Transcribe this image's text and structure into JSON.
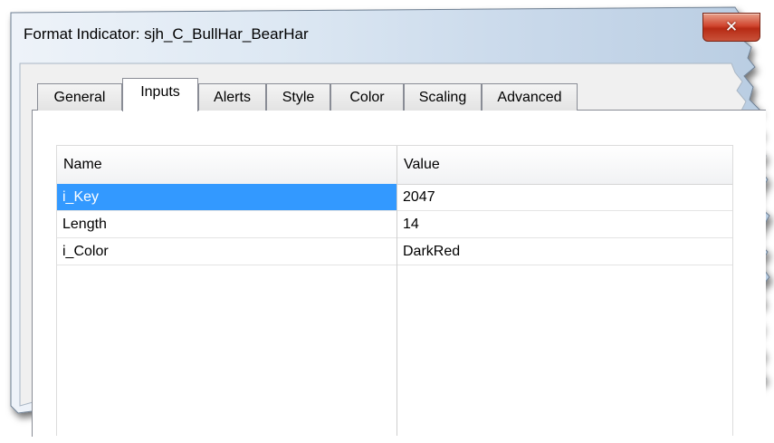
{
  "window": {
    "title": "Format Indicator: sjh_C_BullHar_BearHar",
    "close_glyph": "✕"
  },
  "tabs": [
    {
      "label": "General",
      "active": false
    },
    {
      "label": "Inputs",
      "active": true
    },
    {
      "label": "Alerts",
      "active": false
    },
    {
      "label": "Style",
      "active": false
    },
    {
      "label": "Color",
      "active": false
    },
    {
      "label": "Scaling",
      "active": false
    },
    {
      "label": "Advanced",
      "active": false
    }
  ],
  "grid": {
    "columns": [
      "Name",
      "Value"
    ],
    "rows": [
      {
        "name": "i_Key",
        "value": "2047",
        "selected": true
      },
      {
        "name": "Length",
        "value": "14",
        "selected": false
      },
      {
        "name": "i_Color",
        "value": "DarkRed",
        "selected": false
      }
    ]
  },
  "colors": {
    "selection": "#3399ff",
    "close_button": "#c9523a",
    "titlebar": "#dbe7f3"
  }
}
